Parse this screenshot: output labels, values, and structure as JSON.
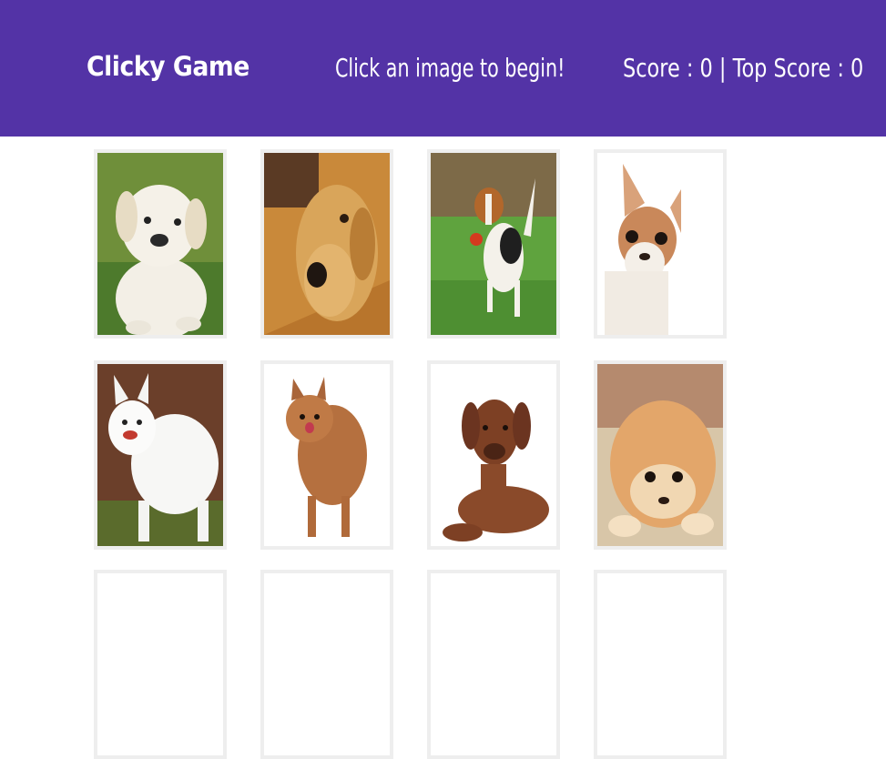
{
  "navbar": {
    "brand": "Clicky Game",
    "message": "Click an image to begin!",
    "score_label": "Score",
    "score": "0",
    "top_score_label": "Top Score",
    "top_score": "0"
  },
  "colors": {
    "navbar_bg": "#5333a6",
    "card_border": "#eeeeee"
  },
  "cards": [
    {
      "name": "white-labrador-puppy-image"
    },
    {
      "name": "golden-retriever-on-floor-image"
    },
    {
      "name": "beagle-with-red-ball-image"
    },
    {
      "name": "chihuahua-peeking-image"
    },
    {
      "name": "white-samoyed-dog-image"
    },
    {
      "name": "pomeranian-standing-image"
    },
    {
      "name": "brown-mastiff-puppy-image"
    },
    {
      "name": "boo-pomeranian-lying-image"
    }
  ]
}
